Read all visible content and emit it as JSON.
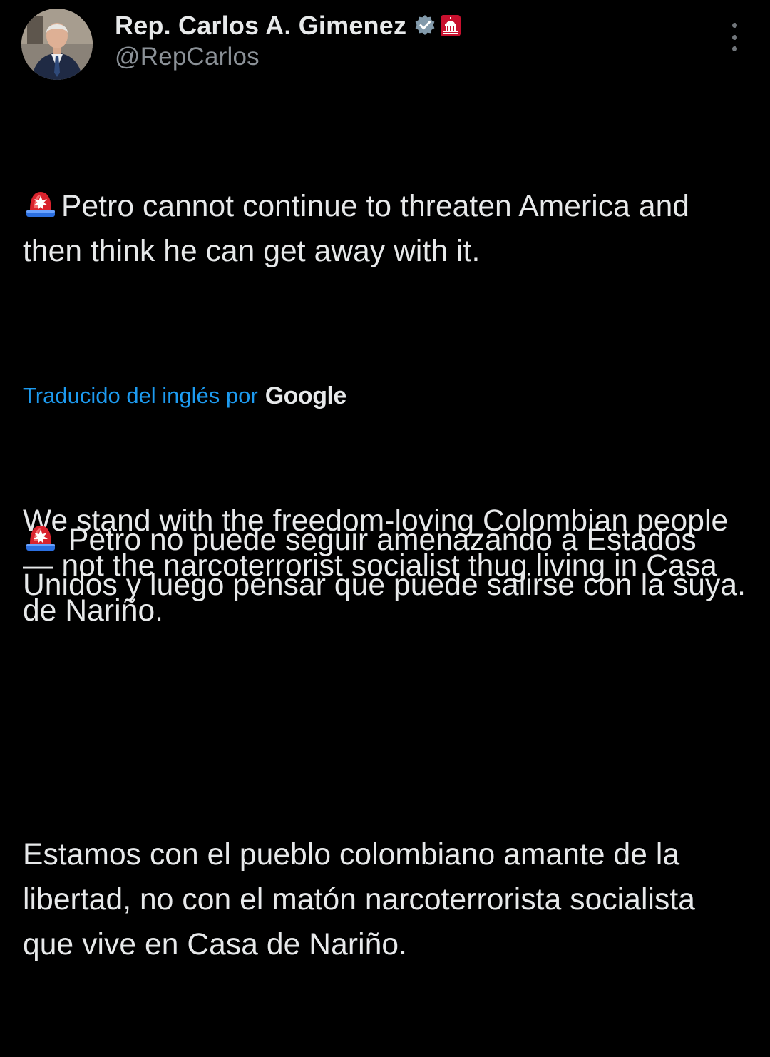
{
  "author": {
    "display_name": "Rep. Carlos A. Gimenez",
    "handle": "@RepCarlos",
    "verified_badge": "verified-badge-icon",
    "government_badge": "capitol-building-icon",
    "avatar": "profile-photo"
  },
  "menu": {
    "more_icon": "more-vertical-icon"
  },
  "original": {
    "icon": "police-siren-emoji",
    "paragraphs": [
      "Petro cannot continue to threaten America and then think he can get away with it.",
      "We stand with the freedom-loving Colombian people — not the narcoterrorist socialist thug living in Casa de Nariño."
    ]
  },
  "translation": {
    "label": "Traducido del inglés por",
    "provider": "Google",
    "icon": "police-siren-emoji",
    "paragraphs": [
      "Petro no puede seguir amenazando a Estados Unidos y luego pensar que puede salirse con la suya.",
      "Estamos con el pueblo colombiano amante de la libertad, no con el matón narcoterrorista socialista que vive en Casa de Nariño."
    ]
  },
  "colors": {
    "background": "#000000",
    "text": "#e7e9ea",
    "secondary_text": "#8b9197",
    "link": "#1d9bf0",
    "badge_gray": "#829aab",
    "gov_badge_red": "#c8102e"
  }
}
